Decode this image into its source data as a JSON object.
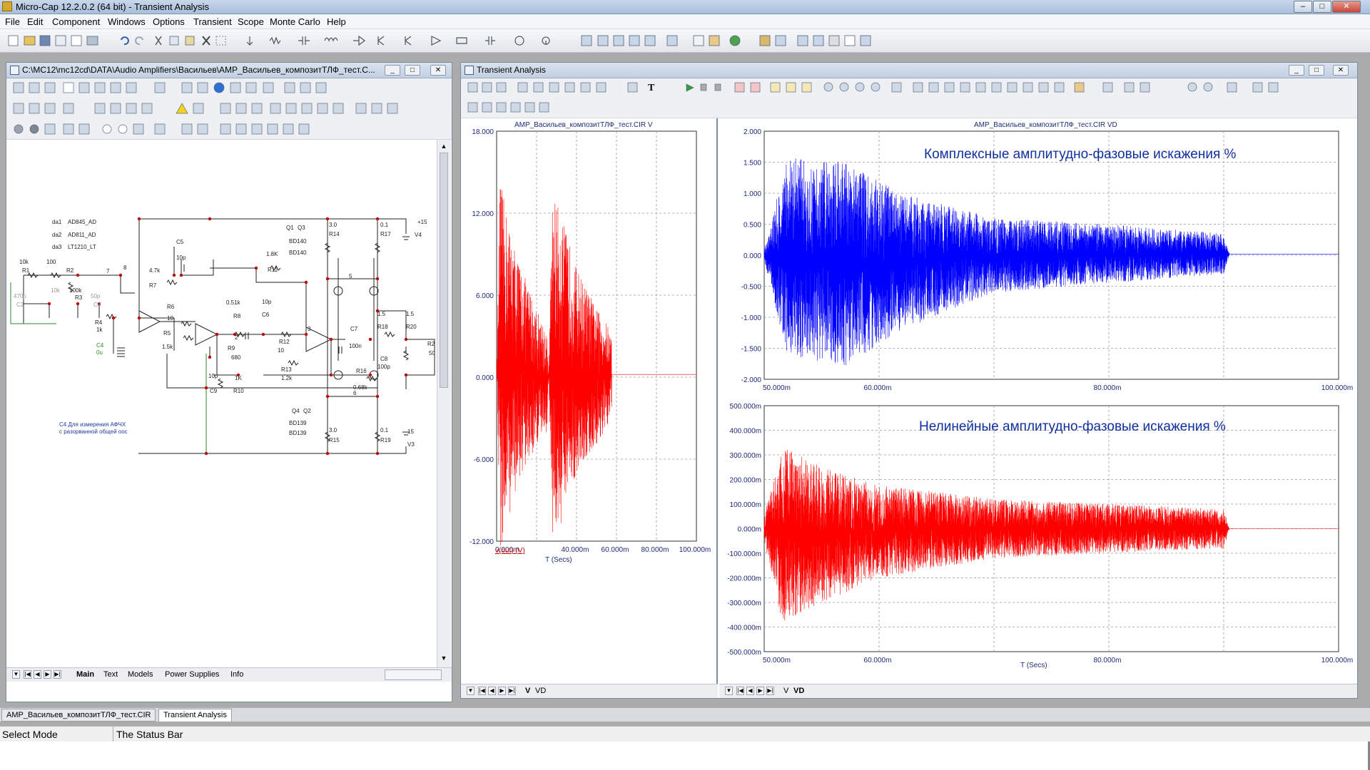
{
  "app": {
    "title": "Micro-Cap 12.2.0.2 (64 bit) - Transient Analysis"
  },
  "menu": [
    "File",
    "Edit",
    "Component",
    "Windows",
    "Options",
    "Transient",
    "Scope",
    "Monte Carlo",
    "Help"
  ],
  "schematic": {
    "title": "C:\\MC12\\mc12cd\\DATA\\Audio Amplifiers\\Васильев\\AMP_Васильев_композитТЛФ_тест.C...",
    "tabs": [
      "Main",
      "Text",
      "Models",
      "Power Supplies",
      "Info"
    ],
    "labels": {
      "da1": "da1",
      "ad845": "AD845_AD",
      "da2": "da2",
      "ad811": "AD811_AD",
      "da3": "da3",
      "lt1210": "LT1210_LT",
      "c5": "C5",
      "c5v": "10p",
      "r1": "R1",
      "r1v": "10k",
      "r2": "R2",
      "r2v": "100",
      "r3": "R3",
      "r3v": "100k",
      "r4": "R4",
      "r4v": "1k",
      "c4": "C4",
      "c4v": "0u",
      "r7": "R7",
      "r7v": "4.7k",
      "r6": "R6",
      "r6v": "10",
      "r5": "R5",
      "r5v": "1.5k",
      "r8": "R8",
      "r8v": "0.51k",
      "c6": "C6",
      "c6v": "10p",
      "r9": "R9",
      "r9v": "680",
      "c9": "C9",
      "c9v": "10p",
      "r10": "R10",
      "r10v": "1K",
      "r11": "R11",
      "r11v": "1.8K",
      "r12": "R12",
      "r12v": "10",
      "r13": "R13",
      "r13v": "1.2k",
      "r16": "R16",
      "r16v": "0.68k",
      "c7": "C7",
      "c7v": "100n",
      "c8": "C8",
      "c8v": "100p",
      "r18": "R18",
      "r18v": "1.5",
      "r20": "R20",
      "r20v": "1.5",
      "r2b": "R2",
      "r2bv": "50",
      "q1": "Q1",
      "q3": "Q3",
      "bd140a": "BD140",
      "bd140b": "BD140",
      "q4": "Q4",
      "q2": "Q2",
      "bd139a": "BD139",
      "bd139b": "BD139",
      "r14": "R14",
      "r14v": "3.0",
      "r17": "R17",
      "r17v": "0.1",
      "r15": "R15",
      "r15v": "3.0",
      "r19": "R19",
      "r19v": "0.1",
      "v4": "V4",
      "v4v": "+15",
      "v3": "V3",
      "v3v": "15",
      "note1": "С4 Для измерения АФЧХ",
      "note2": "с разорванной общей оос",
      "n7": "7",
      "n8": "8",
      "n2": "2",
      "n3": "3",
      "n5": "5",
      "n6": "6",
      "nc2": "C2",
      "nc3": "C3",
      "n470p": "470p",
      "n50p": "50p",
      "n10k": "10k"
    }
  },
  "transient": {
    "title": "Transient Analysis",
    "tabs": [
      "V",
      "VD"
    ],
    "left": {
      "title": "AMP_Васильев_композитТЛФ_тест.CIR V",
      "yticks": [
        "18.000",
        "12.000",
        "6.000",
        "0.000",
        "-6.000",
        "-12.000"
      ],
      "xticks": [
        "0.000m",
        "40.000m",
        "60.000m",
        "80.000m",
        "100.000m"
      ],
      "xlabel": "T (Secs)",
      "trace": "v(out) (V)"
    },
    "rtop": {
      "title": "AMP_Васильев_композитТЛФ_тест.CIR VD",
      "yticks": [
        "2.000",
        "1.500",
        "1.000",
        "0.500",
        "0.000",
        "-0.500",
        "-1.000",
        "-1.500",
        "-2.000"
      ],
      "xticks": [
        "50.000m",
        "60.000m",
        "80.000m",
        "100.000m"
      ],
      "annotation": "Комплексные амплитудно-фазовые искажения %"
    },
    "rbot": {
      "yticks": [
        "500.000m",
        "400.000m",
        "300.000m",
        "200.000m",
        "100.000m",
        "0.000m",
        "-100.000m",
        "-200.000m",
        "-300.000m",
        "-400.000m",
        "-500.000m"
      ],
      "xticks": [
        "50.000m",
        "60.000m",
        "80.000m",
        "100.000m"
      ],
      "xlabel": "T (Secs)",
      "annotation": "Нелинейные амплитудно-фазовые искажения %"
    }
  },
  "chart_data": [
    {
      "type": "line",
      "xlabel": "T (Secs)",
      "ylabel": "",
      "ylim": [
        -12,
        18
      ],
      "xlim": [
        0,
        0.1
      ],
      "series": [
        {
          "name": "v(out) (V)",
          "envelope": {
            "x": [
              0,
              0.0017,
              0.005,
              0.01,
              0.02,
              0.025,
              0.026,
              0.028,
              0.032,
              0.04,
              0.05,
              0.055,
              0.0575,
              0.0575,
              0.1
            ],
            "upper": [
              0,
              14.5,
              12,
              9,
              5,
              3.5,
              0,
              13.5,
              12,
              8,
              5,
              4,
              3,
              0.2,
              0.2
            ],
            "lower": [
              0,
              -13,
              -11,
              -8,
              -5,
              -4,
              0,
              -12,
              -11,
              -7,
              -5,
              -4,
              -2.5,
              0.2,
              0.2
            ]
          }
        }
      ]
    },
    {
      "type": "line",
      "xlabel": "",
      "ylabel": "",
      "ylim": [
        -2,
        2
      ],
      "xlim": [
        0.05,
        0.1
      ],
      "series": [
        {
          "envelope": {
            "x": [
              0.05,
              0.052,
              0.057,
              0.062,
              0.07,
              0.08,
              0.09,
              0.0905,
              0.1
            ],
            "upper": [
              0.1,
              1.6,
              1.5,
              1.0,
              0.6,
              0.5,
              0.35,
              0.02,
              0.02
            ],
            "lower": [
              -0.1,
              -1.6,
              -1.8,
              -1.2,
              -0.6,
              -0.45,
              -0.3,
              0.02,
              0.02
            ]
          }
        }
      ]
    },
    {
      "type": "line",
      "xlabel": "T (Secs)",
      "ylabel": "",
      "ylim": [
        -0.5,
        0.5
      ],
      "xlim": [
        0.05,
        0.1
      ],
      "series": [
        {
          "envelope": {
            "x": [
              0.05,
              0.0515,
              0.055,
              0.06,
              0.07,
              0.08,
              0.09,
              0.0905,
              0.1
            ],
            "upper": [
              0.05,
              0.34,
              0.25,
              0.18,
              0.12,
              0.1,
              0.08,
              0.0,
              0.0
            ],
            "lower": [
              -0.05,
              -0.38,
              -0.3,
              -0.2,
              -0.12,
              -0.1,
              -0.08,
              0.0,
              0.0
            ]
          }
        }
      ]
    }
  ],
  "doctabs": [
    "AMP_Васильев_композитТЛФ_тест.CIR",
    "Transient Analysis"
  ],
  "status": {
    "mode": "Select Mode",
    "bar": "The Status Bar"
  }
}
